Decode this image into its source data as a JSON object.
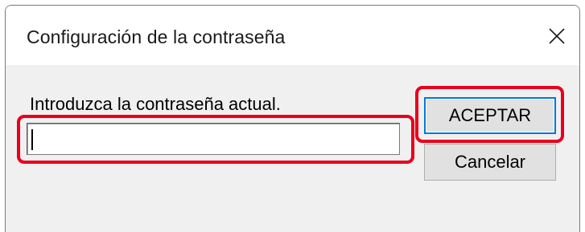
{
  "window": {
    "title": "Configuración de la contraseña",
    "close_icon": "close-icon"
  },
  "form": {
    "prompt": "Introduzca la contraseña actual.",
    "password_value": "",
    "password_placeholder": ""
  },
  "buttons": {
    "ok_label": "ACEPTAR",
    "cancel_label": "Cancelar"
  },
  "highlights": {
    "color": "#e8001c",
    "targets": [
      "password-input",
      "ok-button"
    ]
  },
  "colors": {
    "dialog_bg": "#f0f0f0",
    "titlebar_bg": "#ffffff",
    "default_button_border": "#0078d7"
  }
}
